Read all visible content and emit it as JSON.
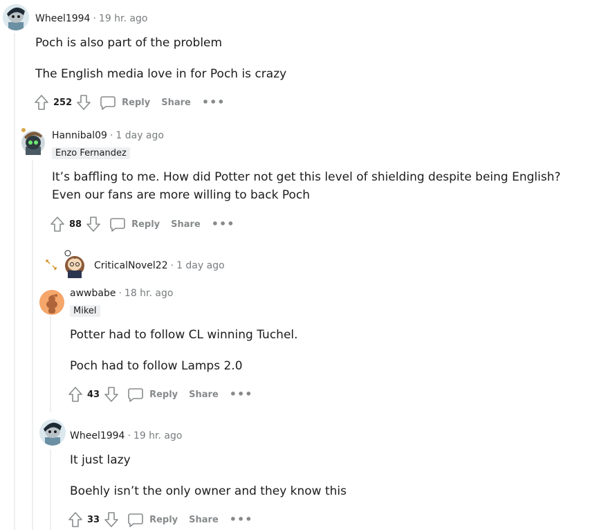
{
  "comments": [
    {
      "author": "Wheel1994",
      "time": "19 hr. ago",
      "paragraphs": [
        "Poch is also part of the problem",
        "The English media love in for Poch is crazy"
      ],
      "score": "252",
      "reply": "Reply",
      "share": "Share"
    },
    {
      "author": "Hannibal09",
      "time": "1 day ago",
      "flair": "Enzo Fernandez",
      "lines": [
        "It’s baffling to me. How did Potter not get this level of shielding despite being English?",
        "Even our fans are more willing to back Poch"
      ],
      "score": "88",
      "reply": "Reply",
      "share": "Share"
    },
    {
      "author": "CriticalNovel22",
      "time": "1 day ago"
    },
    {
      "author": "awwbabe",
      "time": "18 hr. ago",
      "flair": "Mikel",
      "paragraphs": [
        "Potter had to follow CL winning Tuchel.",
        "Poch had to follow Lamps 2.0"
      ],
      "score": "43",
      "reply": "Reply",
      "share": "Share"
    },
    {
      "author": "Wheel1994",
      "time": "19 hr. ago",
      "paragraphs": [
        "It just lazy",
        "Boehly isn’t the only owner and they know this"
      ],
      "score": "33",
      "reply": "Reply",
      "share": "Share"
    }
  ],
  "separator": "·",
  "more_glyph": "•••",
  "colors": {
    "meta": "#787c7e",
    "action": "#878a8c",
    "line": "#edeff1",
    "awwbabe_avatar": "#f5a66a"
  },
  "icons": [
    "upvote-icon",
    "downvote-icon",
    "comment-icon",
    "more-icon",
    "expand-icon"
  ]
}
